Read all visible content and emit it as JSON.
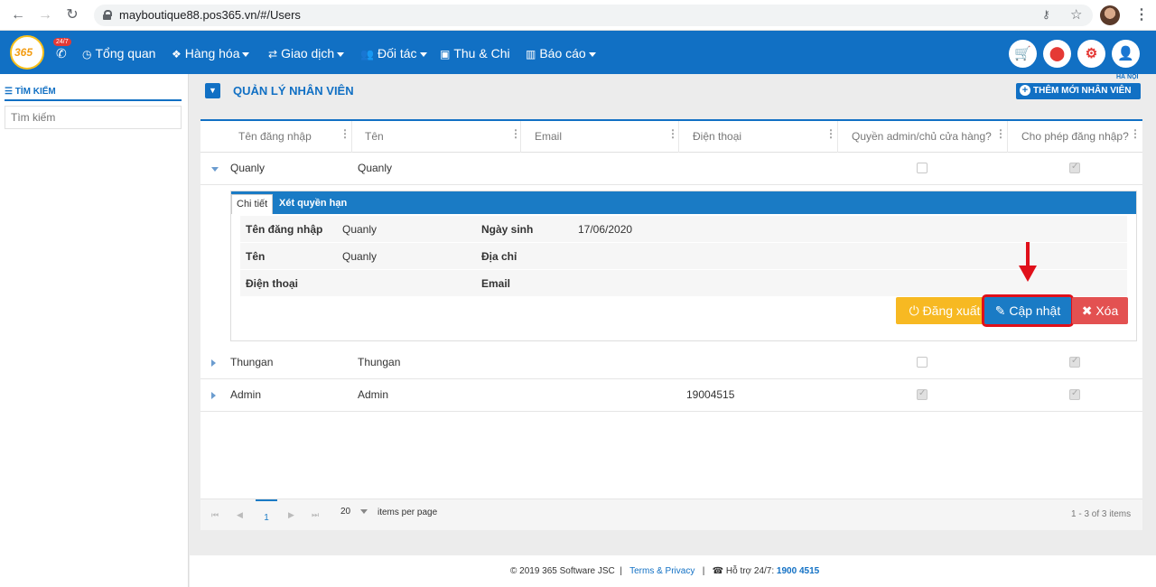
{
  "browser": {
    "back": "←",
    "forward": "→",
    "reload": "↻",
    "url": "mayboutique88.pos365.vn/#/Users"
  },
  "header": {
    "logo_text": "365",
    "badge": "24/7",
    "nav": [
      {
        "label": "Tổng quan",
        "icon": "dashboard-icon",
        "glyph": "◷"
      },
      {
        "label": "Hàng hóa",
        "icon": "cubes-icon",
        "glyph": "❖"
      },
      {
        "label": "Giao dịch",
        "icon": "exchange-icon",
        "glyph": "⇄"
      },
      {
        "label": "Đối tác",
        "icon": "users-icon",
        "glyph": "👥"
      },
      {
        "label": "Thu & Chi",
        "icon": "money-icon",
        "glyph": "▣"
      },
      {
        "label": "Báo cáo",
        "icon": "bar-chart-icon",
        "glyph": "▥"
      }
    ],
    "location_tag": "HÀ NỘI"
  },
  "sidebar": {
    "title": "TÌM KIẾM",
    "search_placeholder": "Tìm kiếm"
  },
  "page": {
    "title": "QUẢN LÝ NHÂN VIÊN",
    "add_button": "THÊM MỚI NHÂN VIÊN"
  },
  "grid": {
    "columns": [
      "Tên đăng nhập",
      "Tên",
      "Email",
      "Điện thoại",
      "Quyền admin/chủ cửa hàng?",
      "Cho phép đăng nhập?"
    ],
    "rows": [
      {
        "username": "Quanly",
        "name": "Quanly",
        "email": "",
        "phone": "",
        "is_admin": false,
        "can_login": true,
        "expanded": true
      },
      {
        "username": "Thungan",
        "name": "Thungan",
        "email": "",
        "phone": "",
        "is_admin": false,
        "can_login": true,
        "expanded": false
      },
      {
        "username": "Admin",
        "name": "Admin",
        "email": "",
        "phone": "19004515",
        "is_admin": true,
        "can_login": true,
        "expanded": false
      }
    ]
  },
  "detail": {
    "tabs": [
      "Chi tiết",
      "Xét quyền hạn"
    ],
    "labels": {
      "username": "Tên đăng nhập",
      "birthday": "Ngày sinh",
      "name": "Tên",
      "address": "Địa chỉ",
      "phone": "Điện thoại",
      "email": "Email"
    },
    "values": {
      "username": "Quanly",
      "birthday": "17/06/2020",
      "name": "Quanly",
      "address": "",
      "phone": "",
      "email": ""
    },
    "buttons": {
      "logout": "Đăng xuất",
      "update": "Cập nhật",
      "delete": "Xóa"
    }
  },
  "pager": {
    "current_page": "1",
    "page_size": "20",
    "items_label": "items per page",
    "info": "1 - 3 of 3 items"
  },
  "footer": {
    "copyright": "© 2019 365 Software JSC",
    "separator": "|",
    "terms": "Terms & Privacy",
    "support_label": "Hỗ trợ 24/7:",
    "support_phone": "1900 4515"
  },
  "colors": {
    "primary": "#1170c4",
    "warning": "#f7b922",
    "danger": "#e35151",
    "highlight": "#e0101a"
  }
}
